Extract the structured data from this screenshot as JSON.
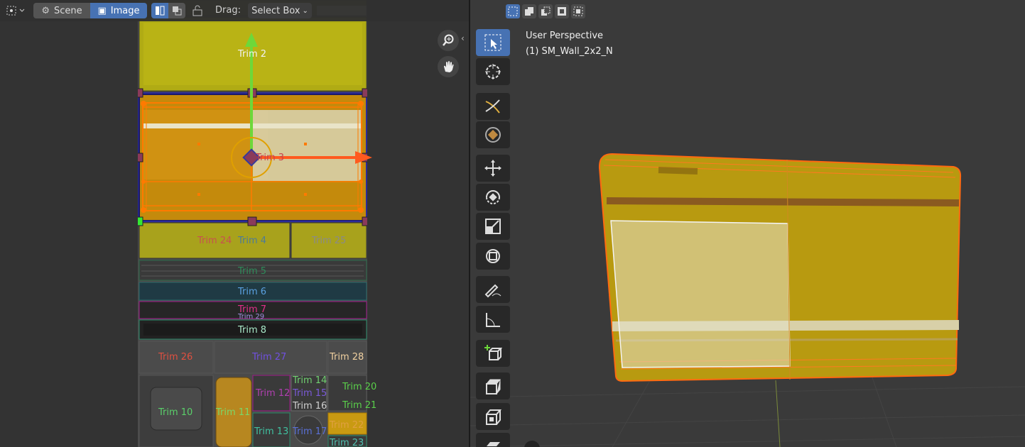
{
  "uv_header": {
    "scene_label": "Scene",
    "image_label": "Image",
    "drag_label": "Drag:",
    "select_mode": "Select Box"
  },
  "uv_trims": {
    "t2": "Trim 2",
    "t3": "Trim 3",
    "t24": "Trim 24",
    "t4": "Trim 4",
    "t25": "Trim 25",
    "t5": "Trim 5",
    "t6": "Trim 6",
    "t7": "Trim 7",
    "t29": "Trim 29",
    "t8": "Trim 8",
    "t26": "Trim 26",
    "t27": "Trim 27",
    "t28": "Trim 28",
    "t10": "Trim 10",
    "t11": "Trim 11",
    "t12": "Trim 12",
    "t14": "Trim 14",
    "t15": "Trim 15",
    "t16": "Trim 16",
    "t20": "Trim 20",
    "t21": "Trim 21",
    "t13": "Trim 13",
    "t17": "Trim 17",
    "t22": "Trim 22",
    "t23": "Trim 23"
  },
  "viewport": {
    "view_name": "User Perspective",
    "object_name": "(1) SM_Wall_2x2_N"
  },
  "colors": {
    "accent": "#4772b3",
    "selection_orange": "#ff7a00",
    "uv_yellow": "#b7a800",
    "gizmo_green": "#6dd83a",
    "gizmo_red": "#ff5a1f"
  }
}
